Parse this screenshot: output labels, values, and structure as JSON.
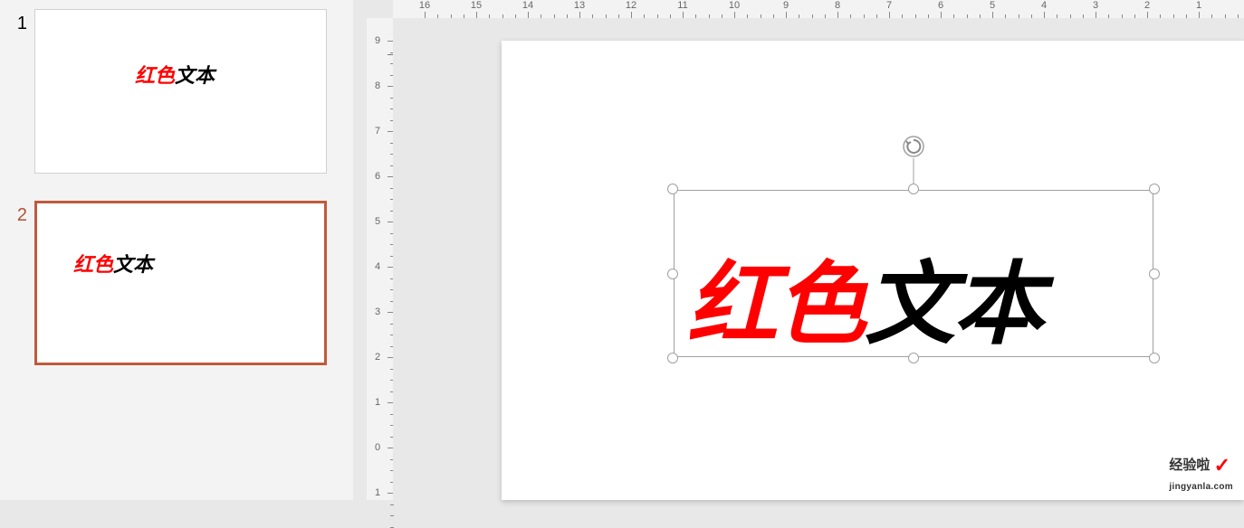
{
  "thumbnails": [
    {
      "number": "1",
      "red_part": "红色",
      "black_part": "文本",
      "active": false
    },
    {
      "number": "2",
      "red_part": "红色",
      "black_part": "文本",
      "active": true
    }
  ],
  "ruler": {
    "horizontal_labels": [
      "16",
      "15",
      "14",
      "13",
      "12",
      "11",
      "10",
      "9",
      "8",
      "7",
      "6",
      "5",
      "4",
      "3",
      "2",
      "1"
    ],
    "vertical_labels": [
      "9",
      "8",
      "7",
      "6",
      "5",
      "4",
      "3",
      "2",
      "1",
      "0",
      "1"
    ]
  },
  "textbox": {
    "red_part": "红色",
    "black_part": "文本"
  },
  "watermark": {
    "title": "经验啦",
    "check": "✓",
    "url": "jingyanla.com"
  }
}
